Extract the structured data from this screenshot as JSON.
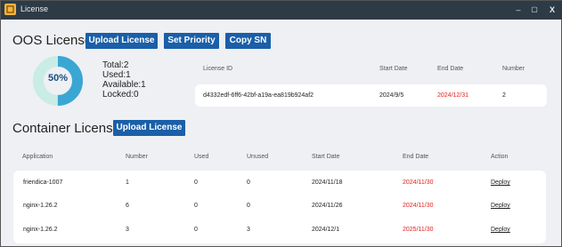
{
  "window": {
    "title": "License"
  },
  "oos": {
    "title": "OOS License",
    "buttons": {
      "upload": "Upload License",
      "priority": "Set Priority",
      "copy": "Copy SN"
    },
    "usage_percent_text": "50%",
    "usage_fraction": 0.5,
    "stats": {
      "total": "Total:2",
      "used": "Used:1",
      "available": "Available:1",
      "locked": "Locked:0"
    },
    "table": {
      "headers": [
        "License ID",
        "Start Date",
        "End Date",
        "Number"
      ],
      "rows": [
        {
          "license_id": "d4332edf-6ff6-42bf-a19a-ea819b924af2",
          "start": "2024/9/5",
          "end": "2024/12/31",
          "number": "2"
        }
      ]
    }
  },
  "container": {
    "title": "Container License",
    "upload_label": "Upload License",
    "headers": [
      "Application",
      "Number",
      "Used",
      "Unused",
      "Start Date",
      "End Date",
      "Action"
    ],
    "rows": [
      {
        "app": "friendica-1007",
        "number": "1",
        "used": "0",
        "unused": "0",
        "start": "2024/11/18",
        "end": "2024/11/30",
        "action": "Deploy"
      },
      {
        "app": "nginx-1.26.2",
        "number": "6",
        "used": "0",
        "unused": "0",
        "start": "2024/11/26",
        "end": "2024/11/30",
        "action": "Deploy"
      },
      {
        "app": "nginx-1.26.2",
        "number": "3",
        "used": "0",
        "unused": "3",
        "start": "2024/12/1",
        "end": "2025/11/30",
        "action": "Deploy"
      }
    ]
  },
  "colors": {
    "accent": "#1a5fa8",
    "expired": "#e02020",
    "donut_fill": "#3aa6d4",
    "donut_track": "#c9ece4"
  }
}
